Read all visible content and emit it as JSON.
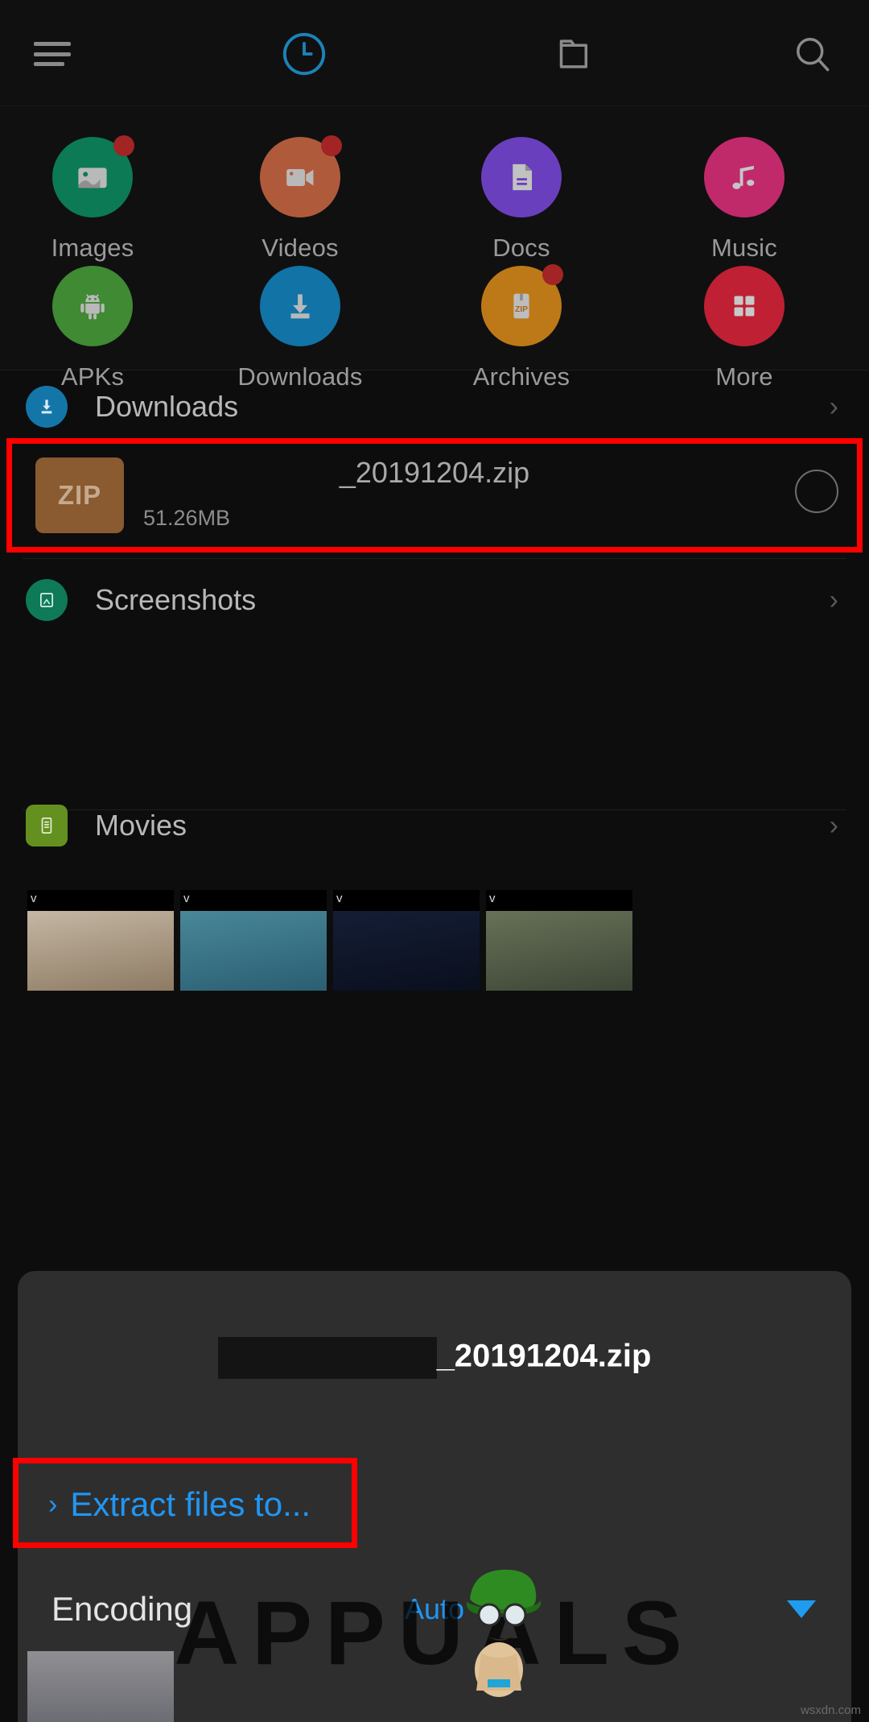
{
  "app": {
    "theme_bg": "#0d0d0d",
    "accent": "#2196f3",
    "highlight": "#ff0000"
  },
  "topbar": {
    "menu_icon": "hamburger-menu-icon",
    "recent_icon": "clock-icon",
    "folder_icon": "folder-icon",
    "search_icon": "search-icon",
    "active_tab": "recent"
  },
  "categories": [
    {
      "label": "Images",
      "icon": "image-icon",
      "color": "#0b7a55",
      "badge": true
    },
    {
      "label": "Videos",
      "icon": "video-icon",
      "color": "#b05a3c",
      "badge": true
    },
    {
      "label": "Docs",
      "icon": "document-icon",
      "color": "#6a3fbd",
      "badge": false
    },
    {
      "label": "Music",
      "icon": "music-note-icon",
      "color": "#c02a6b",
      "badge": false
    },
    {
      "label": "APKs",
      "icon": "android-icon",
      "color": "#3f8a33",
      "badge": false
    },
    {
      "label": "Downloads",
      "icon": "download-icon",
      "color": "#1173a6",
      "badge": false
    },
    {
      "label": "Archives",
      "icon": "zip-file-icon",
      "color": "#bd7918",
      "badge": true
    },
    {
      "label": "More",
      "icon": "grid-icon",
      "color": "#bf2034",
      "badge": false
    }
  ],
  "list": {
    "downloads_folder": {
      "label": "Downloads",
      "icon": "download-circle-icon",
      "color": "#1476a8"
    },
    "screenshots_folder": {
      "label": "Screenshots",
      "icon": "screenshot-icon",
      "color": "#0e7a58"
    },
    "movies_folder": {
      "label": "Movies",
      "icon": "movies-icon",
      "color": "#63901f"
    },
    "file": {
      "name": "_20191204.zip",
      "size": "51.26MB",
      "thumb_label": "ZIP",
      "thumb_color": "#8a5a31",
      "selected": false
    },
    "thumbnails": [
      {
        "name": "video-thumbnail-1",
        "tick": "v"
      },
      {
        "name": "video-thumbnail-2",
        "tick": "v"
      },
      {
        "name": "video-thumbnail-3",
        "tick": "v"
      },
      {
        "name": "video-thumbnail-4",
        "tick": "v"
      }
    ]
  },
  "sheet": {
    "title_redacted": true,
    "title": "_20191204.zip",
    "extract_label": "Extract files to...",
    "extract_chevron": "›",
    "encoding_label": "Encoding",
    "encoding_value": "Auto",
    "encoding_caret": "caret-down-icon"
  },
  "watermark": {
    "text": "APPUALS",
    "url": "wsxdn.com"
  }
}
